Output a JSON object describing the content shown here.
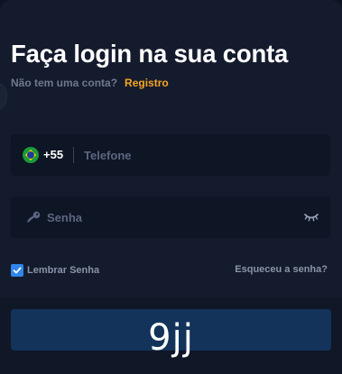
{
  "header": {
    "title": "Faça login na sua conta",
    "no_account": "Não tem uma conta?",
    "register_link": "Registro"
  },
  "phone": {
    "country_flag": "brazil-flag-icon",
    "country_code": "+55",
    "placeholder": "Telefone"
  },
  "password": {
    "icon": "key-icon",
    "placeholder": "Senha",
    "toggle_icon": "eye-closed-icon"
  },
  "options": {
    "remember_label": "Lembrar Senha",
    "remember_checked": true,
    "forgot_link": "Esqueceu a senha?"
  },
  "watermark": "9jj",
  "colors": {
    "background": "#141b2d",
    "field": "#0e1525",
    "accent": "#f6a623",
    "checkbox": "#2f86eb",
    "button": "#13335b"
  }
}
